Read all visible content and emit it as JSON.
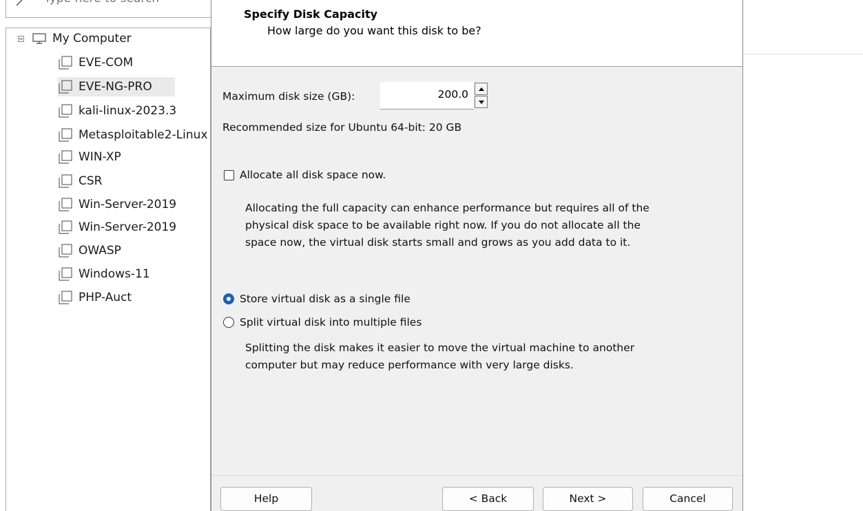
{
  "library": {
    "search_placeholder": "Type here to search",
    "root_label": "My Computer",
    "items": [
      {
        "label": "EVE-COM"
      },
      {
        "label": "EVE-NG-PRO"
      },
      {
        "label": "kali-linux-2023.3"
      },
      {
        "label": "Metasploitable2-Linux"
      },
      {
        "label": "WIN-XP"
      },
      {
        "label": "CSR"
      },
      {
        "label": "Win-Server-2019"
      },
      {
        "label": "Win-Server-2019"
      },
      {
        "label": "OWASP"
      },
      {
        "label": "Windows-11"
      },
      {
        "label": "PHP-Auct"
      }
    ],
    "selected_index": 1
  },
  "dialog": {
    "title": "Specify Disk Capacity",
    "subtitle": "How large do you want this disk to be?",
    "size_label": "Maximum disk size (GB):",
    "size_value": "200.0",
    "recommended": "Recommended size for Ubuntu 64-bit: 20 GB",
    "allocate_label": "Allocate all disk space now.",
    "allocate_checked": false,
    "allocate_desc": [
      "Allocating the full capacity can enhance performance but requires all of the",
      "physical disk space to be available right now. If you do not allocate all the",
      "space now, the virtual disk starts small and grows as you add data to it."
    ],
    "single_file_label": "Store virtual disk as a single file",
    "split_label": "Split virtual disk into multiple files",
    "selected_option": "single",
    "split_desc": [
      "Splitting the disk makes it easier to move the virtual machine to another",
      "computer but may reduce performance with very large disks."
    ],
    "buttons": {
      "help": "Help",
      "back": "< Back",
      "next": "Next >",
      "cancel": "Cancel"
    },
    "accent_color": "#1a5fb4"
  }
}
